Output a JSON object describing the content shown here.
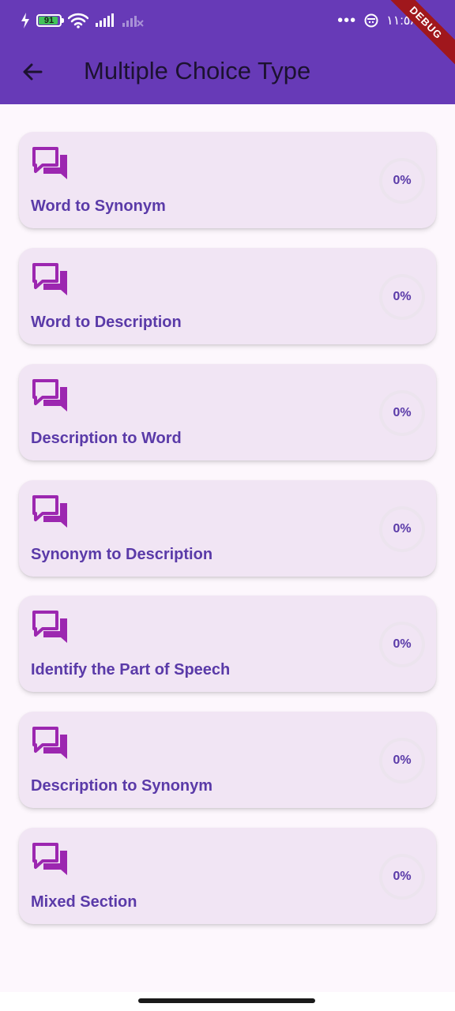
{
  "status_bar": {
    "battery_level": "91",
    "time": "١١:٥٨"
  },
  "debug_banner": "DEBUG",
  "app_bar": {
    "title": "Multiple Choice Type"
  },
  "items": [
    {
      "label": "Word to Synonym",
      "progress": "0%"
    },
    {
      "label": "Word to Description",
      "progress": "0%"
    },
    {
      "label": "Description to Word",
      "progress": "0%"
    },
    {
      "label": "Synonym to Description",
      "progress": "0%"
    },
    {
      "label": "Identify the Part of Speech",
      "progress": "0%"
    },
    {
      "label": "Description to Synonym",
      "progress": "0%"
    },
    {
      "label": "Mixed Section",
      "progress": "0%"
    }
  ],
  "colors": {
    "app_bar": "#673ab7",
    "card": "#f1e5f4",
    "icon": "#9c27b0",
    "label": "#5a3aa8",
    "background": "#fdf7fd"
  }
}
